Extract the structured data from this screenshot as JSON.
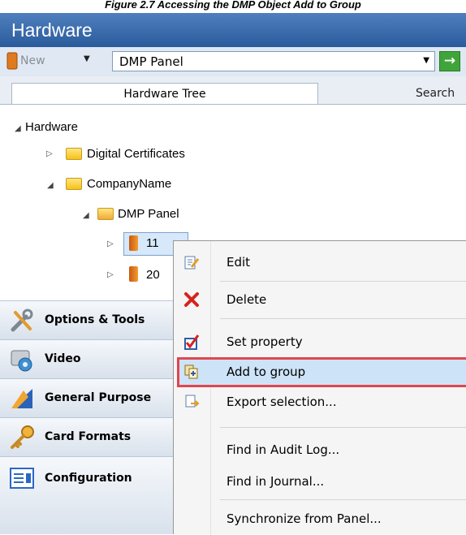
{
  "caption": {
    "text": "Figure 2.7 Accessing the DMP Object Add to Group"
  },
  "window": {
    "title": "Hardware"
  },
  "toolbar": {
    "new_label": "New",
    "type_selected": "DMP Panel",
    "go_glyph": "→"
  },
  "tabs": [
    {
      "label": "Hardware Tree"
    },
    {
      "label": "Search"
    }
  ],
  "tree": {
    "root": "Hardware",
    "items": [
      {
        "label": "Digital Certificates"
      },
      {
        "label": "CompanyName"
      },
      {
        "label": "DMP Panel"
      },
      {
        "label": "11"
      },
      {
        "label": "20"
      }
    ]
  },
  "nav": [
    {
      "label": "Options & Tools",
      "icon": "tools-icon"
    },
    {
      "label": "Video",
      "icon": "camera-icon"
    },
    {
      "label": "General Purpose",
      "icon": "general-purpose-icon"
    },
    {
      "label": "Card Formats",
      "icon": "key-icon"
    },
    {
      "label": "Configuration",
      "icon": "configuration-icon"
    }
  ],
  "context_menu": {
    "items": [
      {
        "label": "Edit",
        "icon": "edit-icon"
      },
      {
        "label": "Delete",
        "icon": "delete-icon"
      },
      {
        "label": "Set property",
        "icon": "checkbox-icon"
      },
      {
        "label": "Add to group",
        "icon": "add-to-group-icon"
      },
      {
        "label": "Export selection...",
        "icon": "export-icon"
      },
      {
        "label": "Find in Audit Log..."
      },
      {
        "label": "Find in Journal..."
      },
      {
        "label": "Synchronize from Panel..."
      }
    ],
    "highlighted": "Add to group",
    "highlight_color": "#e0464e"
  },
  "colors": {
    "title_bar": "#2a5b9c",
    "menu_hover": "#cde3f7"
  }
}
